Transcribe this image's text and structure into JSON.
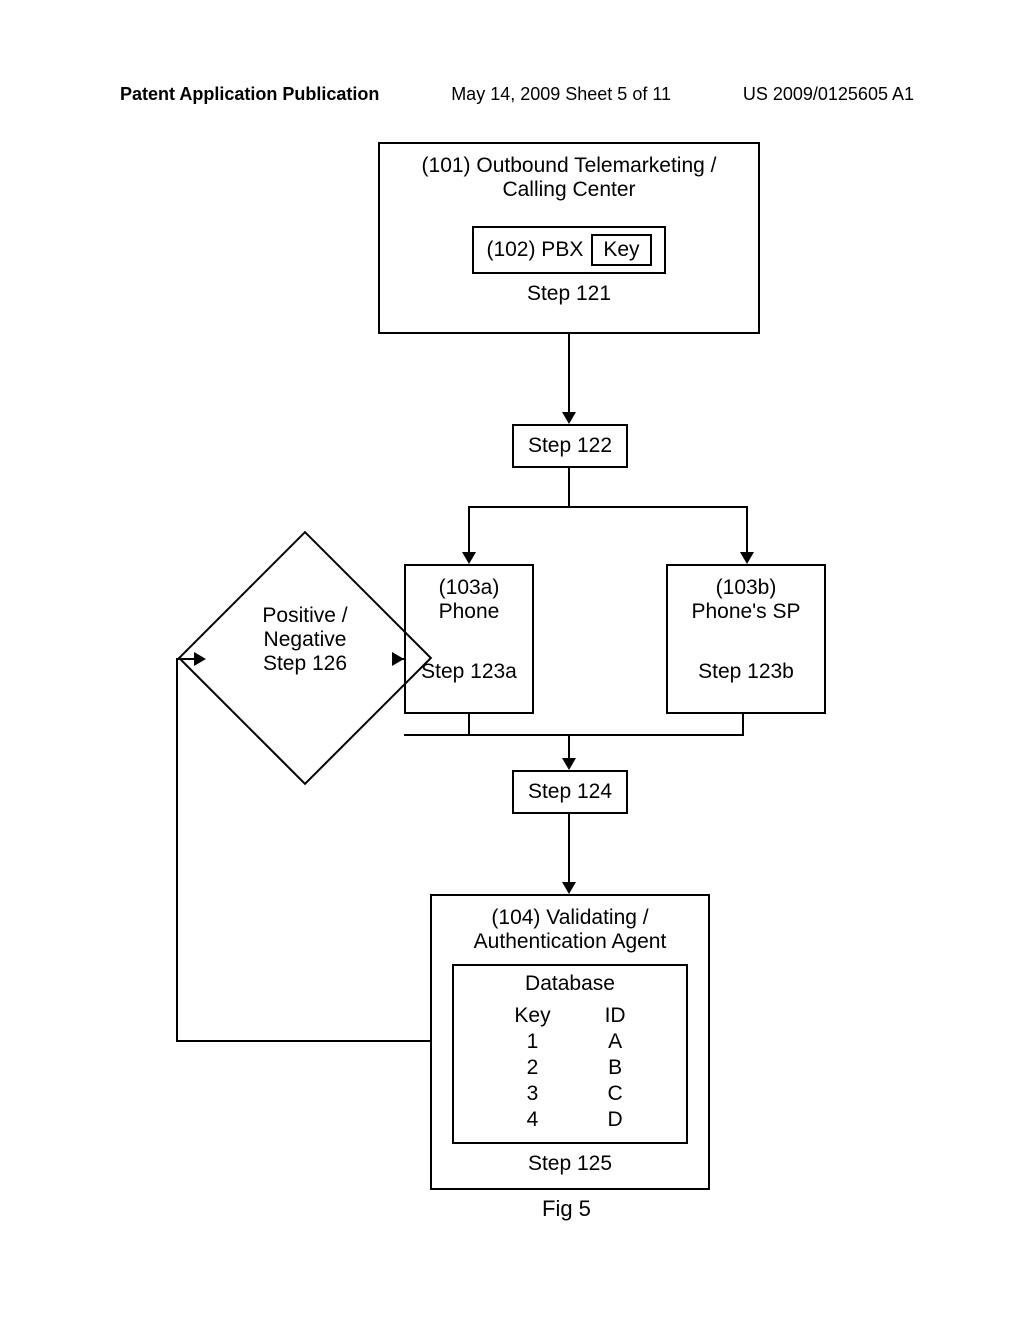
{
  "header": {
    "left": "Patent Application Publication",
    "mid": "May 14, 2009  Sheet 5 of 11",
    "right": "US 2009/0125605 A1"
  },
  "box101": {
    "title_l1": "(101) Outbound Telemarketing /",
    "title_l2": "Calling Center",
    "pbx_label": "(102) PBX",
    "key_label": "Key",
    "step": "Step 121"
  },
  "step122": "Step 122",
  "box103a": {
    "title": "(103a)",
    "sub": "Phone",
    "step": "Step 123a"
  },
  "box103b": {
    "title": "(103b)",
    "sub": "Phone's SP",
    "step": "Step 123b"
  },
  "step124": "Step 124",
  "box104": {
    "title_l1": "(104) Validating /",
    "title_l2": "Authentication Agent",
    "db_title": "Database",
    "col1": "Key",
    "col2": "ID",
    "rows": [
      {
        "k": "1",
        "v": "A"
      },
      {
        "k": "2",
        "v": "B"
      },
      {
        "k": "3",
        "v": "C"
      },
      {
        "k": "4",
        "v": "D"
      }
    ],
    "step": "Step 125"
  },
  "diamond": {
    "l1": "Positive /",
    "l2": "Negative",
    "l3": "Step 126"
  },
  "figure": "Fig 5"
}
